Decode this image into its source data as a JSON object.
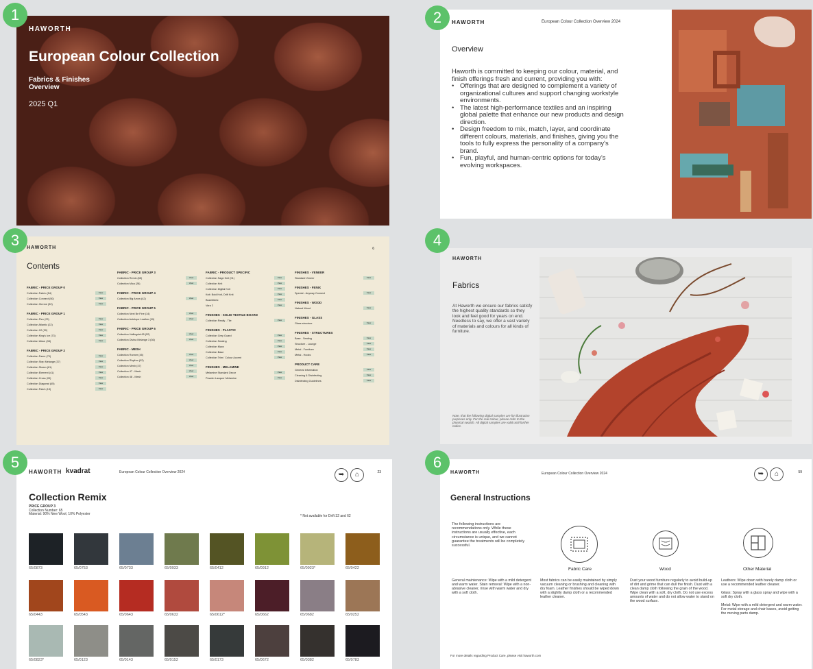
{
  "badges": [
    "1",
    "2",
    "3",
    "4",
    "5",
    "6"
  ],
  "slide1": {
    "brand": "HAWORTH",
    "title": "European Colour Collection",
    "subtitle": "Fabrics & Finishes Overview",
    "date": "2025 Q1"
  },
  "slide2": {
    "brand": "HAWORTH",
    "header": "European Colour Collection Overview 2024",
    "title": "Overview",
    "intro": "Haworth is committed to keeping our colour, material, and finish offerings fresh and current, providing you with:",
    "bullets": [
      "Offerings that are designed to complement a variety of organizational cultures and support changing workstyle environments.",
      "The latest high-performance textiles and an inspiring global palette that enhance our new products and design direction.",
      "Design freedom to mix, match, layer, and coordinate different colours, materials, and finishes, giving you the tools to fully express the personality of a company's brand.",
      "Fun, playful, and human-centric options for today's evolving workspaces."
    ]
  },
  "slide3": {
    "brand": "HAWORTH",
    "page": "6",
    "title": "Contents",
    "view_label": "View",
    "columns": [
      [
        {
          "group": "FABRIC - PRICE GROUP 0",
          "items": [
            "Collection Fabrio (54)",
            "Collection Connect (50)",
            "Collection Xtreme (52)"
          ]
        },
        {
          "group": "FABRIC - PRICE GROUP 1",
          "items": [
            "Collection Flex (23)",
            "Collection Atlantic (22)",
            "Collection X2 (30)",
            "Collection King's Ice (73)",
            "Collection Wave (08)"
          ]
        },
        {
          "group": "FABRIC - PRICE GROUP 2",
          "items": [
            "Collection Fame (70)",
            "Collection Step Melange (37)",
            "Collection Steam (61)",
            "Collection Element (41)",
            "Collection Cross (09)",
            "Collection Diagonal (45)",
            "Collection Patch (13)"
          ]
        }
      ],
      [
        {
          "group": "FABRIC - PRICE GROUP 3",
          "items": [
            "Collection Remix (65)",
            "Collection Mica (28)"
          ]
        },
        {
          "group": "FABRIC - PRICE GROUP 4",
          "items": [
            "Collection Big Arrow (42)"
          ]
        },
        {
          "group": "FABRIC - PRICE GROUP 5",
          "items": [
            "Collection Next Be Fine (14)",
            "Collection Antelope Leather (09)"
          ]
        },
        {
          "group": "FABRIC - PRICE GROUP 6",
          "items": [
            "Collection Hallingdal 65 (52)",
            "Collection Divina Melange 3 (36)"
          ]
        },
        {
          "group": "FABRIC - MESH",
          "items": [
            "Collection Runner (45)",
            "Collection Rhythm (02)",
            "Collection Mesh (47)",
            "Collection 47 - Mesh",
            "Collection 48 - Mesh"
          ]
        }
      ],
      [
        {
          "group": "FABRIC - PRODUCT SPECIFIC",
          "items": [
            "Collection Sage Knit (01)",
            "Collection Knit",
            "Collection Digital Knit",
            "Knit: Bold Knit, Drift Knit",
            "Buzzifabric",
            "Vara 2"
          ]
        },
        {
          "group": "FINISHES - SOLID TEXTILE BOARD",
          "items": [
            "Collection Really - Tile"
          ]
        },
        {
          "group": "FINISHES - PLASTIC",
          "items": [
            "Collection Grey Guard",
            "Collection Seating",
            "Collection Maxx",
            "Collection Base",
            "Collection Trim / Colour Accent"
          ]
        },
        {
          "group": "FINISHES - MELAMINE",
          "items": [
            "Melamine Standard Decor",
            "Powder Lacquer Melamine"
          ]
        }
      ],
      [
        {
          "group": "FINISHES - VENEER",
          "items": [
            "Standard Veneer"
          ]
        },
        {
          "group": "FINISHES - FENIX",
          "items": [
            "Special - Anyway Connect"
          ]
        },
        {
          "group": "FINISHES - WOOD",
          "items": [
            "Natural Wood"
          ]
        },
        {
          "group": "FINISHES - GLASS",
          "items": [
            "Glass structure"
          ]
        },
        {
          "group": "FINISHES - STRUCTURES",
          "items": [
            "Base - Seating",
            "Structure - Lounge",
            "Metal - Furniture",
            "Metal - Hooks"
          ]
        },
        {
          "group": "PRODUCT CARE",
          "items": [
            "General Information",
            "Cleaning & Disinfecting",
            "Disinfecting Guidelines"
          ]
        }
      ]
    ]
  },
  "slide4": {
    "brand": "HAWORTH",
    "title": "Fabrics",
    "body": "At Haworth we ensure our fabrics satisfy the highest quality standards so they look and feel good for years on end. Needless to say, we offer a vast variety of materials and colours for all kinds of furniture.",
    "note": "Note, that the following digital samples are for illustration purposes only. For the real colour, please refer to the physical swatch. All digital samples are valid until further notice."
  },
  "slide5": {
    "brand": "HAWORTH",
    "brand2": "kvadrat",
    "header": "European Colour Collection Overview 2024",
    "page": "23",
    "title": "Collection Remix",
    "price_group": "PRICE GROUP 3",
    "collection_number": "Collection Number: 65",
    "material": "Material: 90% New Wool, 10% Polyester",
    "note": "* Not available for Drift 32 and 62",
    "swatches": [
      {
        "label": "65/0873",
        "color": "#1d2226"
      },
      {
        "label": "65/0753",
        "color": "#32373c"
      },
      {
        "label": "65/0733",
        "color": "#6c7f92"
      },
      {
        "label": "65/0933",
        "color": "#6f7a4d"
      },
      {
        "label": "65/0412",
        "color": "#545424"
      },
      {
        "label": "65/0912",
        "color": "#7e9236"
      },
      {
        "label": "65/0923*",
        "color": "#b6b47a"
      },
      {
        "label": "65/0422",
        "color": "#8d5e1c"
      },
      {
        "label": "65/0443",
        "color": "#a1461c"
      },
      {
        "label": "65/0543",
        "color": "#d95a22"
      },
      {
        "label": "65/0643",
        "color": "#b52c22"
      },
      {
        "label": "65/0632",
        "color": "#b04a3e"
      },
      {
        "label": "65/0612*",
        "color": "#c6877a"
      },
      {
        "label": "65/0662",
        "color": "#4c1e28"
      },
      {
        "label": "65/0682",
        "color": "#8a7e86"
      },
      {
        "label": "65/0252",
        "color": "#9c7656"
      },
      {
        "label": "65/0823*",
        "color": "#a9b9b3"
      },
      {
        "label": "65/0123",
        "color": "#8e8e88"
      },
      {
        "label": "65/0143",
        "color": "#646664"
      },
      {
        "label": "65/0152",
        "color": "#4c4a46"
      },
      {
        "label": "65/0173",
        "color": "#363a3a"
      },
      {
        "label": "65/0672",
        "color": "#4d403e"
      },
      {
        "label": "65/0382",
        "color": "#35312e"
      },
      {
        "label": "65/0783",
        "color": "#1c1b20"
      }
    ]
  },
  "slide6": {
    "brand": "HAWORTH",
    "header": "European Colour Collection Overview 2024",
    "page": "59",
    "title": "General Instructions",
    "intro": "The following instructions are recommendations only. While these instructions are usually effective, each circumstance is unique, and we cannot guarantee the treatments will be completely successful.",
    "general": "General maintenance: Wipe with a mild detergent and warm water. Stain removal: Wipe with a non-abrasive cleaner, rinse with warm water and dry with a soft cloth.",
    "fabric_title": "Fabric Care",
    "fabric_text": "Most fabrics can be easily maintained by simply vacuum cleaning or brushing and cleaning with dry foam. Leather finishes should be wiped down with a slightly damp cloth or a recommended leather cleaner.",
    "wood_title": "Wood",
    "wood_text": "Dust your wood furniture regularly to avoid build-up of dirt and grime that can dull the finish. Dust with a clean damp cloth following the grain of the wood. Wipe clean with a soft, dry cloth. Do not use excess amounts of water and do not allow water to stand on the wood surface.",
    "other_title": "Other Material",
    "other_text_1": "Leathers: Wipe down with barely damp cloth or use a recommended leather cleaner.",
    "other_text_2": "Glass: Spray with a glass spray and wipe with a soft dry cloth.",
    "other_text_3": "Metal: Wipe with a mild detergent and warm water. For metal storage and chair bases, avoid getting the moving parts damp.",
    "footer": "For more details regarding Product Care, please visit haworth.com"
  }
}
